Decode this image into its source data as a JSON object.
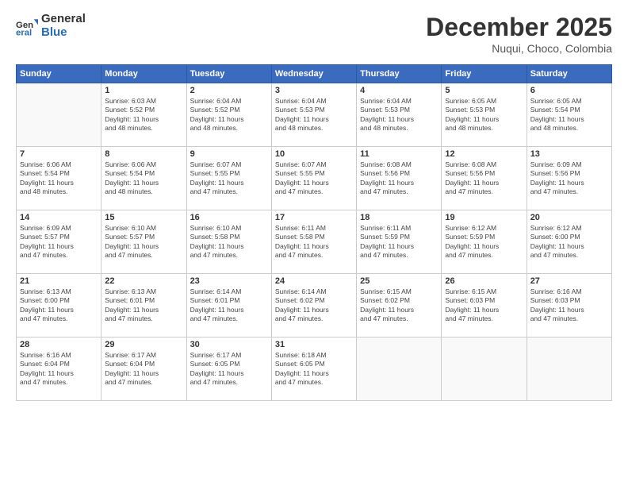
{
  "logo": {
    "general": "General",
    "blue": "Blue"
  },
  "header": {
    "month": "December 2025",
    "location": "Nuqui, Choco, Colombia"
  },
  "weekdays": [
    "Sunday",
    "Monday",
    "Tuesday",
    "Wednesday",
    "Thursday",
    "Friday",
    "Saturday"
  ],
  "weeks": [
    [
      {
        "day": "",
        "info": ""
      },
      {
        "day": "1",
        "info": "Sunrise: 6:03 AM\nSunset: 5:52 PM\nDaylight: 11 hours\nand 48 minutes."
      },
      {
        "day": "2",
        "info": "Sunrise: 6:04 AM\nSunset: 5:52 PM\nDaylight: 11 hours\nand 48 minutes."
      },
      {
        "day": "3",
        "info": "Sunrise: 6:04 AM\nSunset: 5:53 PM\nDaylight: 11 hours\nand 48 minutes."
      },
      {
        "day": "4",
        "info": "Sunrise: 6:04 AM\nSunset: 5:53 PM\nDaylight: 11 hours\nand 48 minutes."
      },
      {
        "day": "5",
        "info": "Sunrise: 6:05 AM\nSunset: 5:53 PM\nDaylight: 11 hours\nand 48 minutes."
      },
      {
        "day": "6",
        "info": "Sunrise: 6:05 AM\nSunset: 5:54 PM\nDaylight: 11 hours\nand 48 minutes."
      }
    ],
    [
      {
        "day": "7",
        "info": "Sunrise: 6:06 AM\nSunset: 5:54 PM\nDaylight: 11 hours\nand 48 minutes."
      },
      {
        "day": "8",
        "info": "Sunrise: 6:06 AM\nSunset: 5:54 PM\nDaylight: 11 hours\nand 48 minutes."
      },
      {
        "day": "9",
        "info": "Sunrise: 6:07 AM\nSunset: 5:55 PM\nDaylight: 11 hours\nand 47 minutes."
      },
      {
        "day": "10",
        "info": "Sunrise: 6:07 AM\nSunset: 5:55 PM\nDaylight: 11 hours\nand 47 minutes."
      },
      {
        "day": "11",
        "info": "Sunrise: 6:08 AM\nSunset: 5:56 PM\nDaylight: 11 hours\nand 47 minutes."
      },
      {
        "day": "12",
        "info": "Sunrise: 6:08 AM\nSunset: 5:56 PM\nDaylight: 11 hours\nand 47 minutes."
      },
      {
        "day": "13",
        "info": "Sunrise: 6:09 AM\nSunset: 5:56 PM\nDaylight: 11 hours\nand 47 minutes."
      }
    ],
    [
      {
        "day": "14",
        "info": "Sunrise: 6:09 AM\nSunset: 5:57 PM\nDaylight: 11 hours\nand 47 minutes."
      },
      {
        "day": "15",
        "info": "Sunrise: 6:10 AM\nSunset: 5:57 PM\nDaylight: 11 hours\nand 47 minutes."
      },
      {
        "day": "16",
        "info": "Sunrise: 6:10 AM\nSunset: 5:58 PM\nDaylight: 11 hours\nand 47 minutes."
      },
      {
        "day": "17",
        "info": "Sunrise: 6:11 AM\nSunset: 5:58 PM\nDaylight: 11 hours\nand 47 minutes."
      },
      {
        "day": "18",
        "info": "Sunrise: 6:11 AM\nSunset: 5:59 PM\nDaylight: 11 hours\nand 47 minutes."
      },
      {
        "day": "19",
        "info": "Sunrise: 6:12 AM\nSunset: 5:59 PM\nDaylight: 11 hours\nand 47 minutes."
      },
      {
        "day": "20",
        "info": "Sunrise: 6:12 AM\nSunset: 6:00 PM\nDaylight: 11 hours\nand 47 minutes."
      }
    ],
    [
      {
        "day": "21",
        "info": "Sunrise: 6:13 AM\nSunset: 6:00 PM\nDaylight: 11 hours\nand 47 minutes."
      },
      {
        "day": "22",
        "info": "Sunrise: 6:13 AM\nSunset: 6:01 PM\nDaylight: 11 hours\nand 47 minutes."
      },
      {
        "day": "23",
        "info": "Sunrise: 6:14 AM\nSunset: 6:01 PM\nDaylight: 11 hours\nand 47 minutes."
      },
      {
        "day": "24",
        "info": "Sunrise: 6:14 AM\nSunset: 6:02 PM\nDaylight: 11 hours\nand 47 minutes."
      },
      {
        "day": "25",
        "info": "Sunrise: 6:15 AM\nSunset: 6:02 PM\nDaylight: 11 hours\nand 47 minutes."
      },
      {
        "day": "26",
        "info": "Sunrise: 6:15 AM\nSunset: 6:03 PM\nDaylight: 11 hours\nand 47 minutes."
      },
      {
        "day": "27",
        "info": "Sunrise: 6:16 AM\nSunset: 6:03 PM\nDaylight: 11 hours\nand 47 minutes."
      }
    ],
    [
      {
        "day": "28",
        "info": "Sunrise: 6:16 AM\nSunset: 6:04 PM\nDaylight: 11 hours\nand 47 minutes."
      },
      {
        "day": "29",
        "info": "Sunrise: 6:17 AM\nSunset: 6:04 PM\nDaylight: 11 hours\nand 47 minutes."
      },
      {
        "day": "30",
        "info": "Sunrise: 6:17 AM\nSunset: 6:05 PM\nDaylight: 11 hours\nand 47 minutes."
      },
      {
        "day": "31",
        "info": "Sunrise: 6:18 AM\nSunset: 6:05 PM\nDaylight: 11 hours\nand 47 minutes."
      },
      {
        "day": "",
        "info": ""
      },
      {
        "day": "",
        "info": ""
      },
      {
        "day": "",
        "info": ""
      }
    ]
  ]
}
